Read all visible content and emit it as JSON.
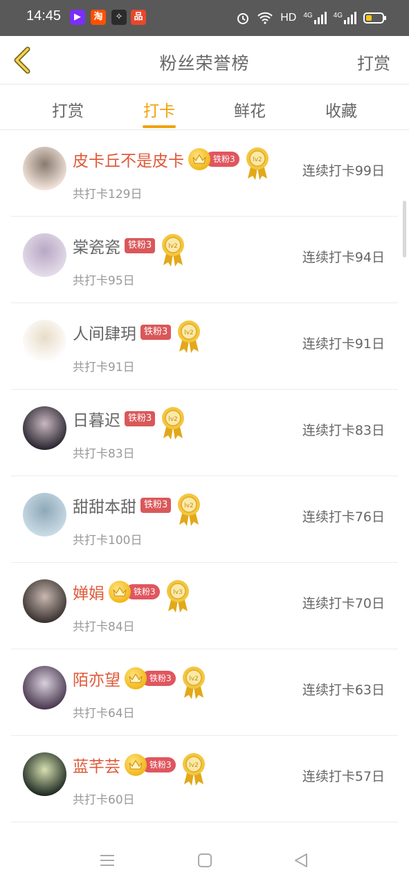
{
  "status_bar": {
    "time": "14:45",
    "app_icons": [
      {
        "name": "video-app-icon",
        "glyph": "▶",
        "color": "#7b2ff7"
      },
      {
        "name": "taobao-icon",
        "glyph": "淘",
        "color": "#ff5000"
      },
      {
        "name": "compass-app-icon",
        "glyph": "✧",
        "color": "#2b2b2b"
      },
      {
        "name": "qidian-app-icon",
        "glyph": "品",
        "color": "#e8472b"
      }
    ],
    "network": "HD",
    "signal_1": "4G",
    "signal_2": "4G"
  },
  "header": {
    "title": "粉丝荣誉榜",
    "action_label": "打赏",
    "back_icon": "chevron-left-icon"
  },
  "tabs": [
    {
      "label": "打赏",
      "active": false
    },
    {
      "label": "打卡",
      "active": true
    },
    {
      "label": "鲜花",
      "active": false
    },
    {
      "label": "收藏",
      "active": false
    }
  ],
  "accent_color": "#f0a30a",
  "fans": [
    {
      "name": "皮卡丘不是皮卡",
      "vip": true,
      "badge": "铁粉3",
      "medal": "lv2",
      "total": "共打卡129日",
      "streak": "连续打卡99日",
      "avatar_colors": [
        "#f4e6dc",
        "#8a7a70"
      ]
    },
    {
      "name": "棠瓷瓷",
      "vip": false,
      "badge": "铁粉3",
      "medal": "lv2",
      "total": "共打卡95日",
      "streak": "连续打卡94日",
      "avatar_colors": [
        "#e5dcea",
        "#b8a8c4"
      ]
    },
    {
      "name": "人间肆玥",
      "vip": false,
      "badge": "铁粉3",
      "medal": "lv2",
      "total": "共打卡91日",
      "streak": "连续打卡91日",
      "avatar_colors": [
        "#ffffff",
        "#e8dcc8"
      ]
    },
    {
      "name": "日暮迟",
      "vip": false,
      "badge": "铁粉3",
      "medal": "lv2",
      "total": "共打卡83日",
      "streak": "连续打卡83日",
      "avatar_colors": [
        "#2a2630",
        "#c9b8c0"
      ]
    },
    {
      "name": "甜甜本甜",
      "vip": false,
      "badge": "铁粉3",
      "medal": "lv2",
      "total": "共打卡100日",
      "streak": "连续打卡76日",
      "avatar_colors": [
        "#c9dce6",
        "#8fa8b8"
      ]
    },
    {
      "name": "婵娟",
      "vip": true,
      "badge": "铁粉3",
      "medal": "lv3",
      "total": "共打卡84日",
      "streak": "连续打卡70日",
      "avatar_colors": [
        "#3a3230",
        "#c8b8b0"
      ]
    },
    {
      "name": "陌亦望",
      "vip": true,
      "badge": "铁粉3",
      "medal": "lv2",
      "total": "共打卡64日",
      "streak": "连续打卡63日",
      "avatar_colors": [
        "#4a3850",
        "#d8d0dc"
      ]
    },
    {
      "name": "蓝芊芸",
      "vip": true,
      "badge": "铁粉3",
      "medal": "lv2",
      "total": "共打卡60日",
      "streak": "连续打卡57日",
      "avatar_colors": [
        "#1e2a22",
        "#d6e0b0"
      ]
    }
  ],
  "nav": [
    "menu-icon",
    "home-square-icon",
    "back-triangle-icon"
  ]
}
